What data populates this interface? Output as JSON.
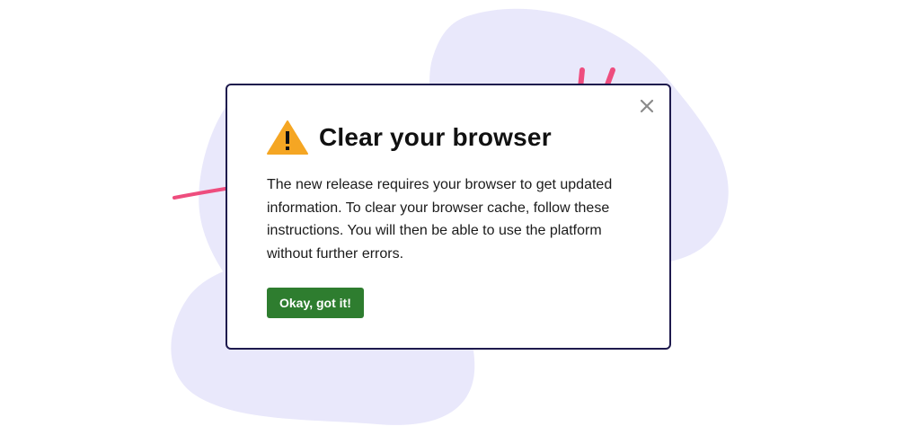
{
  "dialog": {
    "title": "Clear your browser",
    "message": "The new release requires your browser to get updated information. To clear your browser cache, follow these instructions. You will then be able to use the platform without further errors.",
    "confirm_label": "Okay, got it!",
    "close_icon": "close-icon",
    "warning_icon": "warning-triangle-icon"
  },
  "colors": {
    "blob": "#e9e8fb",
    "border": "#1e1a4d",
    "accent": "#ee4d7e",
    "warning": "#f5a623",
    "button": "#2e7d2f"
  }
}
